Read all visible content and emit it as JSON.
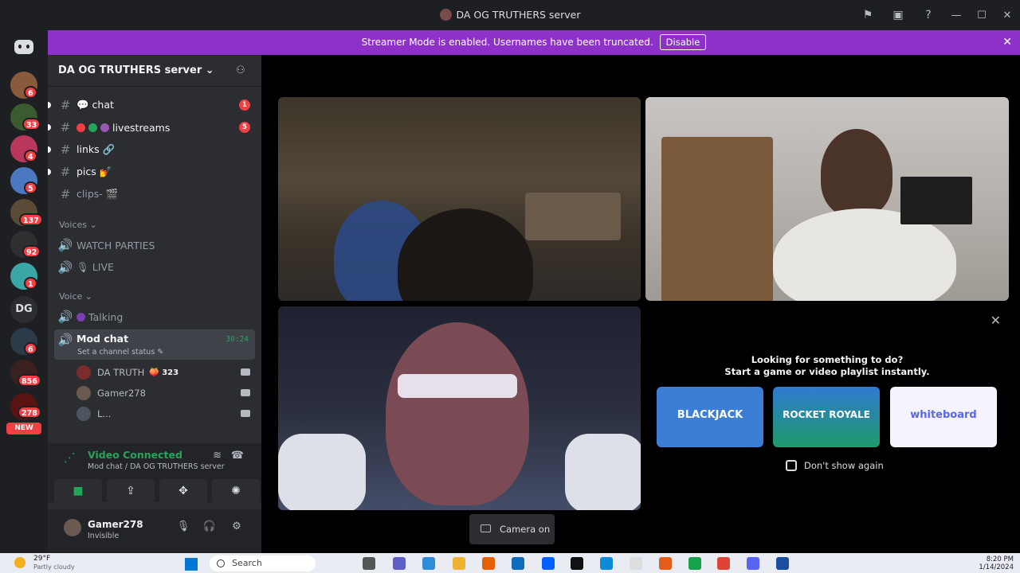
{
  "window": {
    "title": "DA OG TRUTHERS server"
  },
  "banner": {
    "text": "Streamer Mode is enabled. Usernames have been truncated.",
    "disable_label": "Disable"
  },
  "server": {
    "name": "DA OG TRUTHERS server"
  },
  "rail": {
    "badges": [
      "6",
      "33",
      "4",
      "5",
      "137",
      "92",
      "1",
      "6",
      "856",
      "278"
    ],
    "dg_label": "DG",
    "new_label": "NEW"
  },
  "channels": [
    {
      "label": "chat",
      "count": "1"
    },
    {
      "label": "livestreams",
      "count": "5"
    },
    {
      "label": "links"
    },
    {
      "label": "pics"
    },
    {
      "label": "clips-"
    }
  ],
  "categories": {
    "voices": "Voices",
    "voice": "Voice"
  },
  "voice_channels": [
    "WATCH PARTIES",
    "LIVE",
    "Talking"
  ],
  "mod_chat": {
    "label": "Mod chat",
    "timer": "30:24",
    "status_placeholder": "Set a channel status"
  },
  "voice_users": [
    {
      "name": "DA TRUTH",
      "extra": "323"
    },
    {
      "name": "Gamer278"
    },
    {
      "name": "L..."
    }
  ],
  "voice_panel": {
    "title": "Video Connected",
    "subtitle": "Mod chat / DA OG TRUTHERS server"
  },
  "user": {
    "name": "Gamer278",
    "status": "Invisible"
  },
  "activity": {
    "heading1": "Looking for something to do?",
    "heading2": "Start a game or video playlist instantly.",
    "cards": [
      "BLACKJACK",
      "ROCKET ROYALE",
      "whiteboard"
    ],
    "checkbox_label": "Don't show again"
  },
  "camera_button": {
    "label": "Camera on"
  },
  "taskbar": {
    "temp": "29°F",
    "weather": "Partly cloudy",
    "search": "Search",
    "time": "8:20 PM",
    "date": "1/14/2024"
  },
  "colors": {
    "banner": "#8d31c8",
    "accent_green": "#23a55a",
    "badge_red": "#f23f43"
  }
}
